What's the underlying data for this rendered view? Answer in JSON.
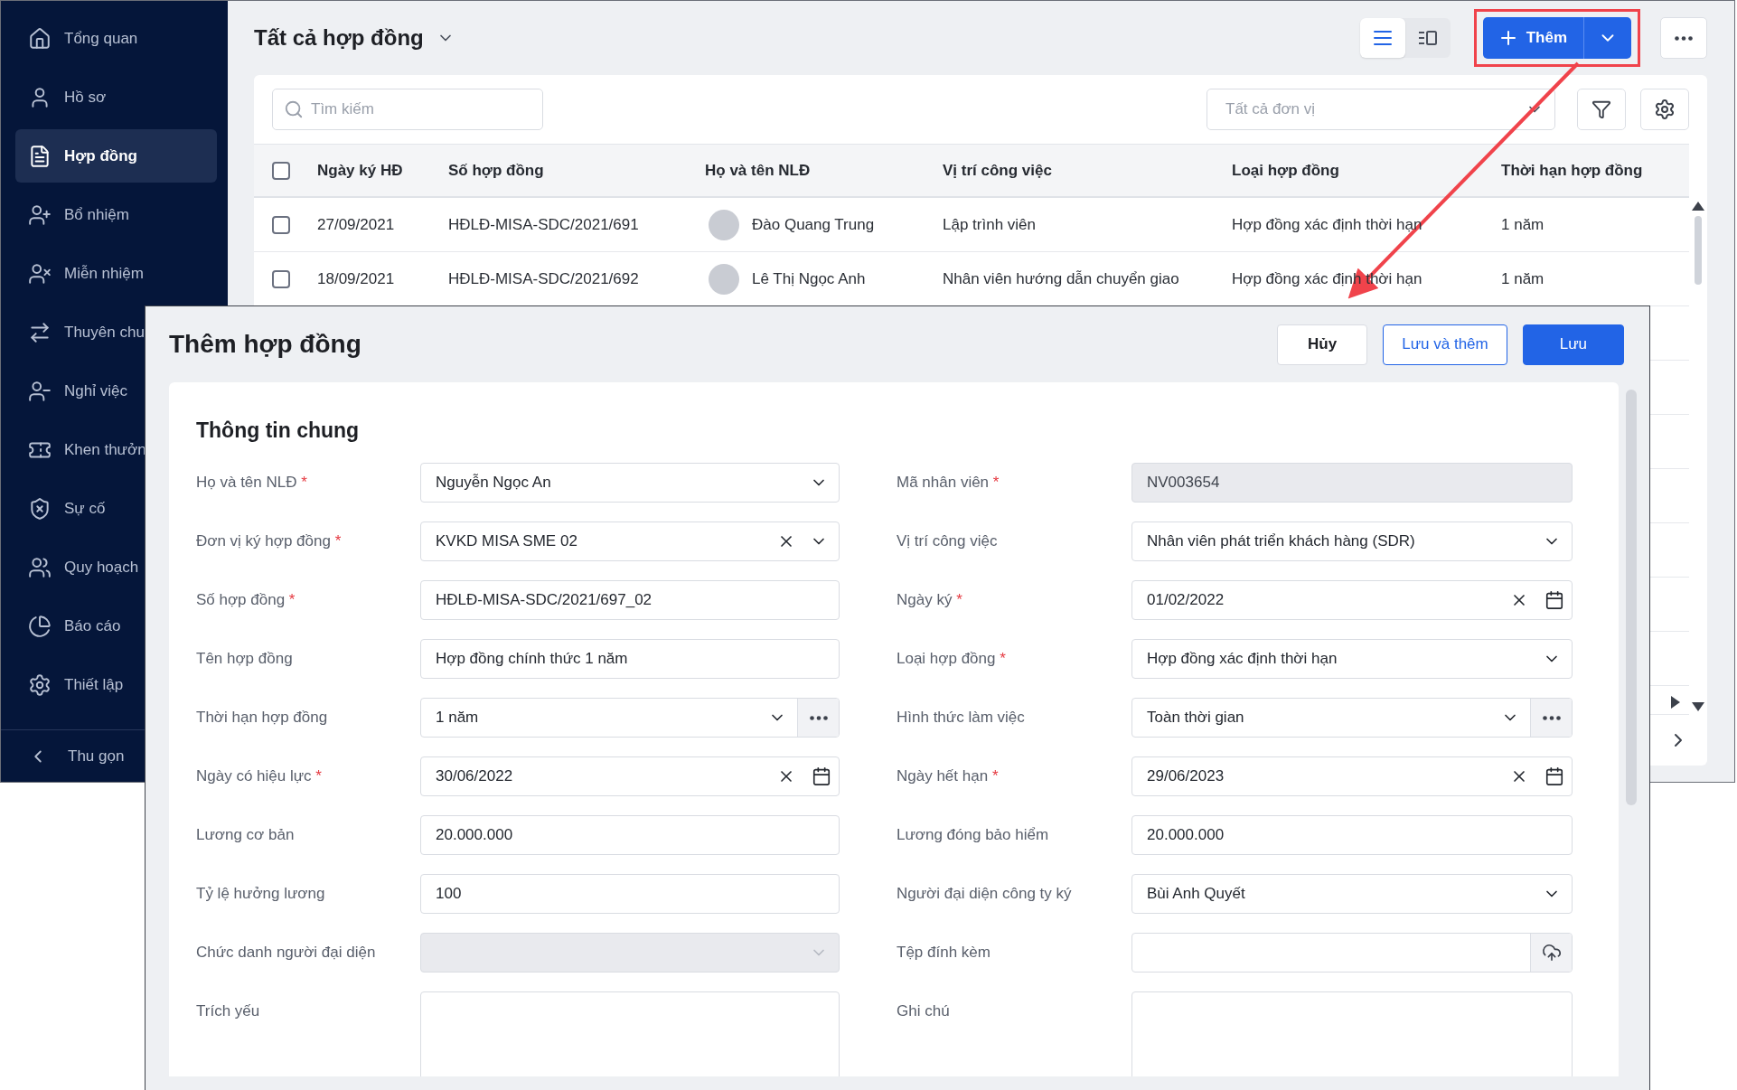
{
  "sidebar": {
    "items": [
      {
        "label": "Tổng quan",
        "selected": false
      },
      {
        "label": "Hồ sơ",
        "selected": false
      },
      {
        "label": "Hợp đồng",
        "selected": true
      },
      {
        "label": "Bổ nhiệm",
        "selected": false
      },
      {
        "label": "Miễn nhiệm",
        "selected": false
      },
      {
        "label": "Thuyên chu",
        "selected": false
      },
      {
        "label": "Nghỉ việc",
        "selected": false
      },
      {
        "label": "Khen thưởn",
        "selected": false
      },
      {
        "label": "Sự cố",
        "selected": false
      },
      {
        "label": "Quy hoạch",
        "selected": false
      },
      {
        "label": "Báo cáo",
        "selected": false
      },
      {
        "label": "Thiết lập",
        "selected": false
      }
    ],
    "collapse": "Thu gọn"
  },
  "header": {
    "title": "Tất cả hợp đồng",
    "view_modes": [
      {
        "kind": "list",
        "selected": true
      },
      {
        "kind": "split",
        "selected": false
      }
    ],
    "add_button": "Thêm"
  },
  "toolbar": {
    "search_placeholder": "Tìm kiếm",
    "unit_placeholder": "Tất cả đơn vị"
  },
  "table": {
    "select_all_checked": false,
    "columns": [
      "Ngày ký HĐ",
      "Số hợp đồng",
      "Họ và tên NLĐ",
      "Vị trí công việc",
      "Loại hợp đồng",
      "Thời hạn hợp đồng"
    ],
    "rows": [
      {
        "checked": false,
        "cells": [
          "27/09/2021",
          "HĐLĐ-MISA-SDC/2021/691",
          "Đào Quang Trung",
          "Lập trình viên",
          "Hợp đồng xác định thời hạn",
          "1 năm"
        ]
      },
      {
        "checked": false,
        "cells": [
          "18/09/2021",
          "HĐLĐ-MISA-SDC/2021/692",
          "Lê Thị Ngọc Anh",
          "Nhân viên hướng dẫn chuyển giao",
          "Hợp đồng xác định thời hạn",
          "1 năm"
        ]
      }
    ]
  },
  "dialog": {
    "title": "Thêm hợp đồng",
    "buttons": [
      {
        "label": "Hủy",
        "kind": "secondary"
      },
      {
        "label": "Lưu và thêm",
        "kind": "outline"
      },
      {
        "label": "Lưu",
        "kind": "primary"
      }
    ],
    "section": "Thông tin chung",
    "required_mark": "*",
    "left_fields": [
      {
        "label": "Họ và tên NLĐ",
        "required": true,
        "kind": "select",
        "value": "Nguyễn Ngọc An"
      },
      {
        "label": "Đơn vị ký hợp đồng",
        "required": true,
        "kind": "select-clear",
        "value": "KVKD MISA SME 02"
      },
      {
        "label": "Số hợp đồng",
        "required": true,
        "kind": "text",
        "value": "HĐLĐ-MISA-SDC/2021/697_02"
      },
      {
        "label": "Tên hợp đồng",
        "required": false,
        "kind": "text",
        "value": "Hợp đồng chính thức 1 năm"
      },
      {
        "label": "Thời hạn hợp đồng",
        "required": false,
        "kind": "select-more",
        "value": "1 năm"
      },
      {
        "label": "Ngày có hiệu lực",
        "required": true,
        "kind": "date",
        "value": "30/06/2022"
      },
      {
        "label": "Lương cơ bản",
        "required": false,
        "kind": "text",
        "value": "20.000.000"
      },
      {
        "label": "Tỷ lệ hưởng lương",
        "required": false,
        "kind": "text",
        "value": "100"
      },
      {
        "label": "Chức danh người đại diện",
        "required": false,
        "kind": "disabled-select"
      },
      {
        "label": "Trích yếu",
        "required": false,
        "kind": "textarea"
      }
    ],
    "right_fields": [
      {
        "label": "Mã nhân viên",
        "required": true,
        "kind": "readonly",
        "value": "NV003654"
      },
      {
        "label": "Vị trí công việc",
        "required": false,
        "kind": "select",
        "value": "Nhân viên phát triển khách hàng (SDR)"
      },
      {
        "label": "Ngày ký",
        "required": true,
        "kind": "date",
        "value": "01/02/2022"
      },
      {
        "label": "Loại hợp đồng",
        "required": true,
        "kind": "select",
        "value": "Hợp đồng xác định thời hạn"
      },
      {
        "label": "Hình thức làm việc",
        "required": false,
        "kind": "select-more",
        "value": "Toàn thời gian"
      },
      {
        "label": "Ngày hết hạn",
        "required": true,
        "kind": "date",
        "value": "29/06/2023"
      },
      {
        "label": "Lương đóng bảo hiểm",
        "required": false,
        "kind": "text",
        "value": "20.000.000"
      },
      {
        "label": "Người đại diện công ty ký",
        "required": false,
        "kind": "select",
        "value": "Bùi Anh Quyết"
      },
      {
        "label": "Tệp đính kèm",
        "required": false,
        "kind": "upload"
      },
      {
        "label": "Ghi chú",
        "required": false,
        "kind": "textarea"
      }
    ]
  }
}
